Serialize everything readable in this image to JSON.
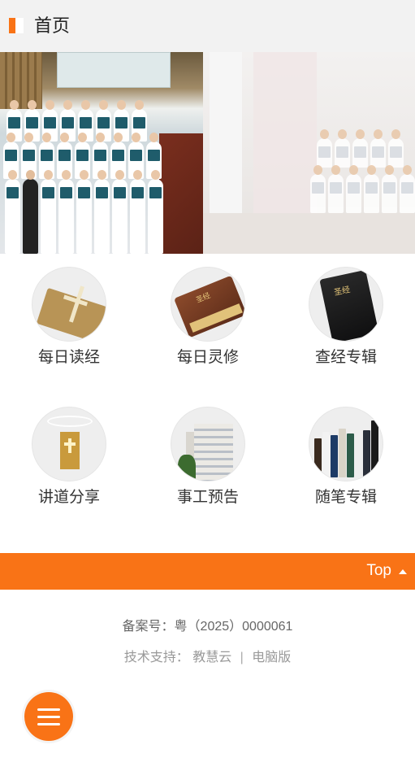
{
  "header": {
    "title": "首页"
  },
  "banner": {
    "slides": [
      "choir-photo",
      "choir-performance-photo"
    ]
  },
  "menu": {
    "items": [
      {
        "label": "每日读经",
        "icon": "bible-cross-icon"
      },
      {
        "label": "每日灵修",
        "icon": "bible-book-icon"
      },
      {
        "label": "查经专辑",
        "icon": "black-bible-icon"
      },
      {
        "label": "讲道分享",
        "icon": "church-altar-icon"
      },
      {
        "label": "事工预告",
        "icon": "church-building-icon"
      },
      {
        "label": "随笔专辑",
        "icon": "bookshelf-icon"
      }
    ],
    "cover_text": "圣经"
  },
  "top_bar": {
    "label": "Top"
  },
  "footer": {
    "icp": "备案号：粤（2025）0000061",
    "support_label": "技术支持：",
    "support_vendor": "教慧云",
    "separator": "|",
    "desktop_link": "电脑版"
  },
  "colors": {
    "accent": "#f97316",
    "header_bg": "#f2f2f2"
  }
}
